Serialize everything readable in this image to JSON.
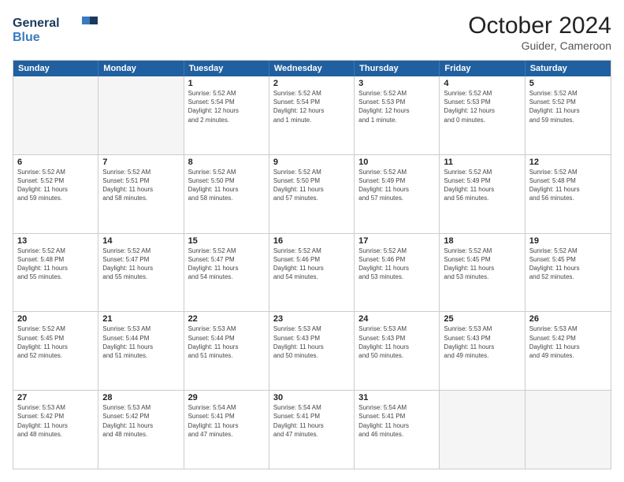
{
  "header": {
    "logo_line1": "General",
    "logo_line2": "Blue",
    "month": "October 2024",
    "location": "Guider, Cameroon"
  },
  "days": [
    "Sunday",
    "Monday",
    "Tuesday",
    "Wednesday",
    "Thursday",
    "Friday",
    "Saturday"
  ],
  "weeks": [
    [
      {
        "num": "",
        "info": ""
      },
      {
        "num": "",
        "info": ""
      },
      {
        "num": "1",
        "info": "Sunrise: 5:52 AM\nSunset: 5:54 PM\nDaylight: 12 hours\nand 2 minutes."
      },
      {
        "num": "2",
        "info": "Sunrise: 5:52 AM\nSunset: 5:54 PM\nDaylight: 12 hours\nand 1 minute."
      },
      {
        "num": "3",
        "info": "Sunrise: 5:52 AM\nSunset: 5:53 PM\nDaylight: 12 hours\nand 1 minute."
      },
      {
        "num": "4",
        "info": "Sunrise: 5:52 AM\nSunset: 5:53 PM\nDaylight: 12 hours\nand 0 minutes."
      },
      {
        "num": "5",
        "info": "Sunrise: 5:52 AM\nSunset: 5:52 PM\nDaylight: 11 hours\nand 59 minutes."
      }
    ],
    [
      {
        "num": "6",
        "info": "Sunrise: 5:52 AM\nSunset: 5:52 PM\nDaylight: 11 hours\nand 59 minutes."
      },
      {
        "num": "7",
        "info": "Sunrise: 5:52 AM\nSunset: 5:51 PM\nDaylight: 11 hours\nand 58 minutes."
      },
      {
        "num": "8",
        "info": "Sunrise: 5:52 AM\nSunset: 5:50 PM\nDaylight: 11 hours\nand 58 minutes."
      },
      {
        "num": "9",
        "info": "Sunrise: 5:52 AM\nSunset: 5:50 PM\nDaylight: 11 hours\nand 57 minutes."
      },
      {
        "num": "10",
        "info": "Sunrise: 5:52 AM\nSunset: 5:49 PM\nDaylight: 11 hours\nand 57 minutes."
      },
      {
        "num": "11",
        "info": "Sunrise: 5:52 AM\nSunset: 5:49 PM\nDaylight: 11 hours\nand 56 minutes."
      },
      {
        "num": "12",
        "info": "Sunrise: 5:52 AM\nSunset: 5:48 PM\nDaylight: 11 hours\nand 56 minutes."
      }
    ],
    [
      {
        "num": "13",
        "info": "Sunrise: 5:52 AM\nSunset: 5:48 PM\nDaylight: 11 hours\nand 55 minutes."
      },
      {
        "num": "14",
        "info": "Sunrise: 5:52 AM\nSunset: 5:47 PM\nDaylight: 11 hours\nand 55 minutes."
      },
      {
        "num": "15",
        "info": "Sunrise: 5:52 AM\nSunset: 5:47 PM\nDaylight: 11 hours\nand 54 minutes."
      },
      {
        "num": "16",
        "info": "Sunrise: 5:52 AM\nSunset: 5:46 PM\nDaylight: 11 hours\nand 54 minutes."
      },
      {
        "num": "17",
        "info": "Sunrise: 5:52 AM\nSunset: 5:46 PM\nDaylight: 11 hours\nand 53 minutes."
      },
      {
        "num": "18",
        "info": "Sunrise: 5:52 AM\nSunset: 5:45 PM\nDaylight: 11 hours\nand 53 minutes."
      },
      {
        "num": "19",
        "info": "Sunrise: 5:52 AM\nSunset: 5:45 PM\nDaylight: 11 hours\nand 52 minutes."
      }
    ],
    [
      {
        "num": "20",
        "info": "Sunrise: 5:52 AM\nSunset: 5:45 PM\nDaylight: 11 hours\nand 52 minutes."
      },
      {
        "num": "21",
        "info": "Sunrise: 5:53 AM\nSunset: 5:44 PM\nDaylight: 11 hours\nand 51 minutes."
      },
      {
        "num": "22",
        "info": "Sunrise: 5:53 AM\nSunset: 5:44 PM\nDaylight: 11 hours\nand 51 minutes."
      },
      {
        "num": "23",
        "info": "Sunrise: 5:53 AM\nSunset: 5:43 PM\nDaylight: 11 hours\nand 50 minutes."
      },
      {
        "num": "24",
        "info": "Sunrise: 5:53 AM\nSunset: 5:43 PM\nDaylight: 11 hours\nand 50 minutes."
      },
      {
        "num": "25",
        "info": "Sunrise: 5:53 AM\nSunset: 5:43 PM\nDaylight: 11 hours\nand 49 minutes."
      },
      {
        "num": "26",
        "info": "Sunrise: 5:53 AM\nSunset: 5:42 PM\nDaylight: 11 hours\nand 49 minutes."
      }
    ],
    [
      {
        "num": "27",
        "info": "Sunrise: 5:53 AM\nSunset: 5:42 PM\nDaylight: 11 hours\nand 48 minutes."
      },
      {
        "num": "28",
        "info": "Sunrise: 5:53 AM\nSunset: 5:42 PM\nDaylight: 11 hours\nand 48 minutes."
      },
      {
        "num": "29",
        "info": "Sunrise: 5:54 AM\nSunset: 5:41 PM\nDaylight: 11 hours\nand 47 minutes."
      },
      {
        "num": "30",
        "info": "Sunrise: 5:54 AM\nSunset: 5:41 PM\nDaylight: 11 hours\nand 47 minutes."
      },
      {
        "num": "31",
        "info": "Sunrise: 5:54 AM\nSunset: 5:41 PM\nDaylight: 11 hours\nand 46 minutes."
      },
      {
        "num": "",
        "info": ""
      },
      {
        "num": "",
        "info": ""
      }
    ]
  ]
}
